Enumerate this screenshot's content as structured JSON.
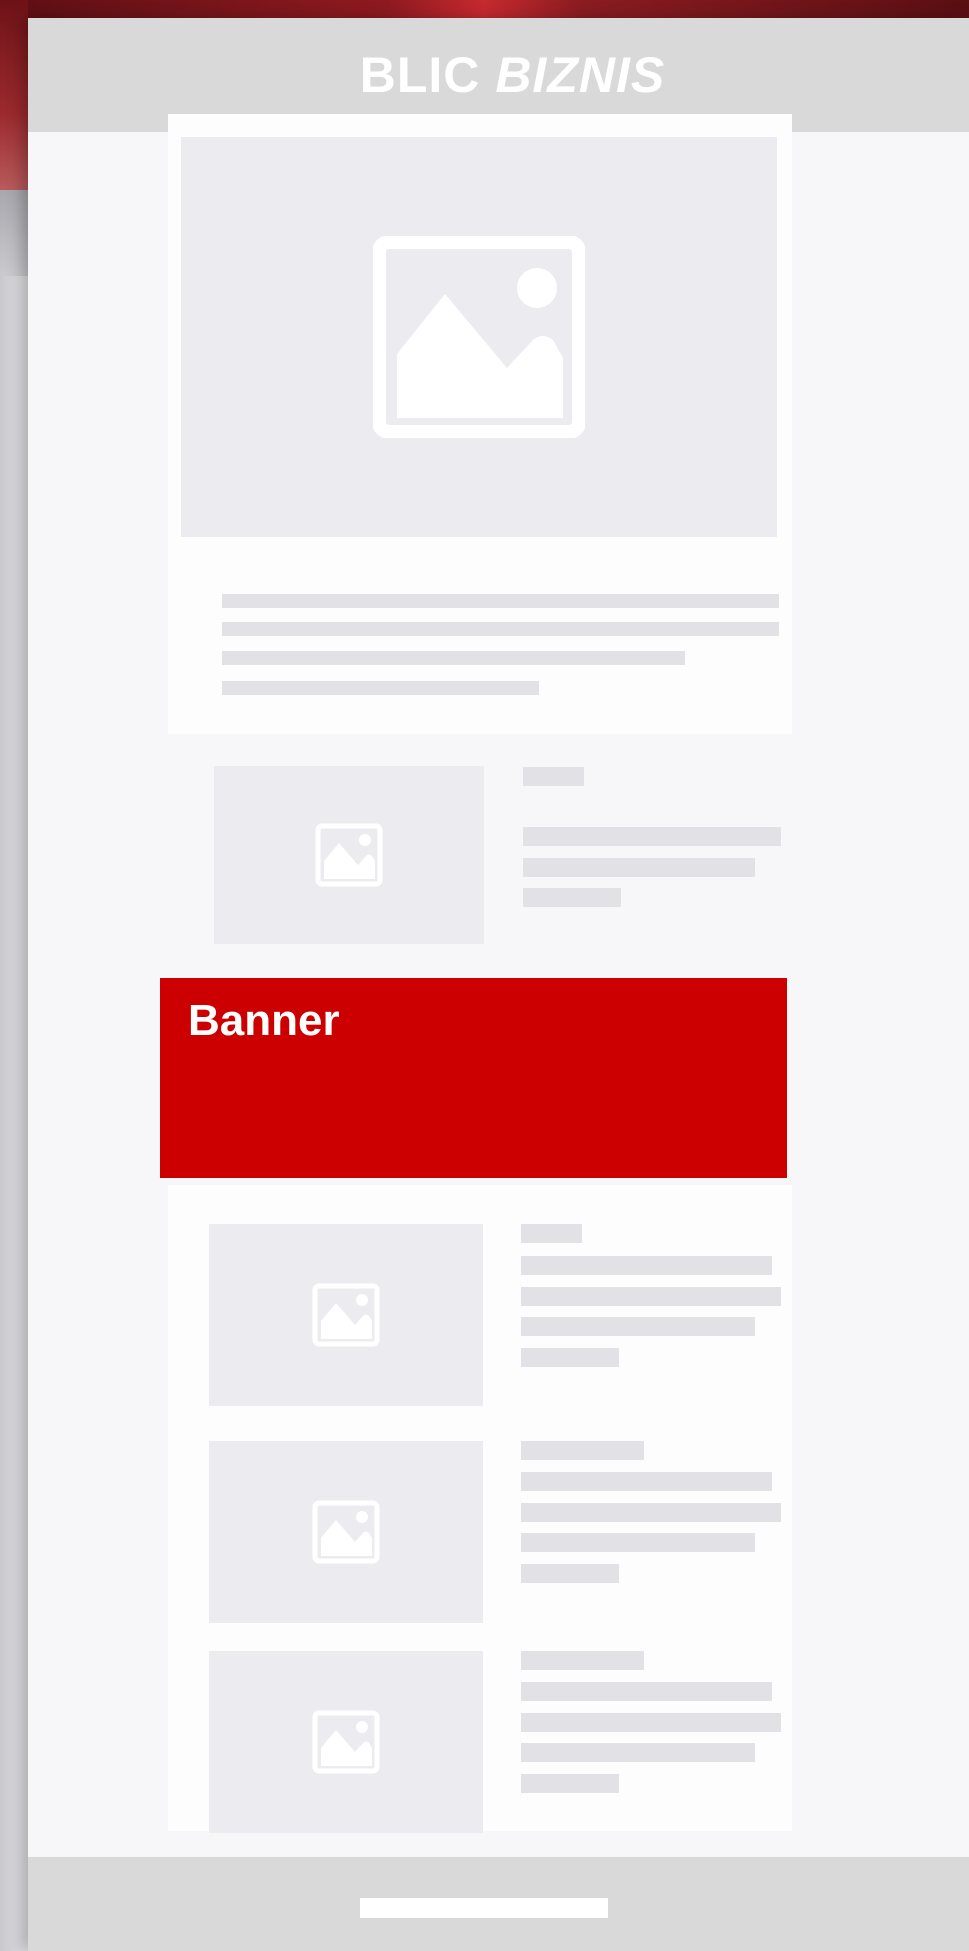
{
  "header": {
    "logo_part1": "BLIC",
    "logo_part2": "BIZNIS"
  },
  "banner": {
    "label": "Banner"
  },
  "icons": {
    "image_placeholder": "image-placeholder-icon"
  },
  "colors": {
    "banner_bg": "#cc0000",
    "header_bg": "#d9d9d9",
    "placeholder_bg": "#ececf0",
    "text_line": "#e2e2e6"
  }
}
